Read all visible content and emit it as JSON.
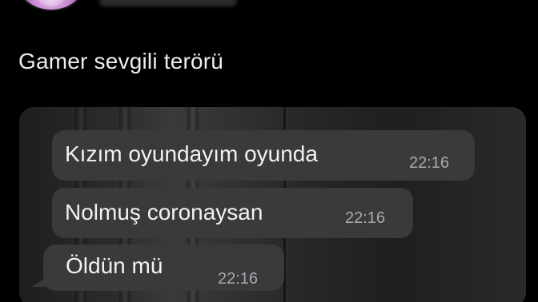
{
  "tweet": {
    "text": "Gamer sevgili terörü"
  },
  "messages": [
    {
      "text": "Kızım oyundayım oyunda",
      "time": "22:16"
    },
    {
      "text": "Nolmuş coronaysan",
      "time": "22:16"
    },
    {
      "text": "Öldün mü",
      "time": "22:16"
    }
  ],
  "colors": {
    "background": "#000000",
    "bubble": "#3a3a3c",
    "text": "#ecedee",
    "time": "#a9a9ad"
  }
}
